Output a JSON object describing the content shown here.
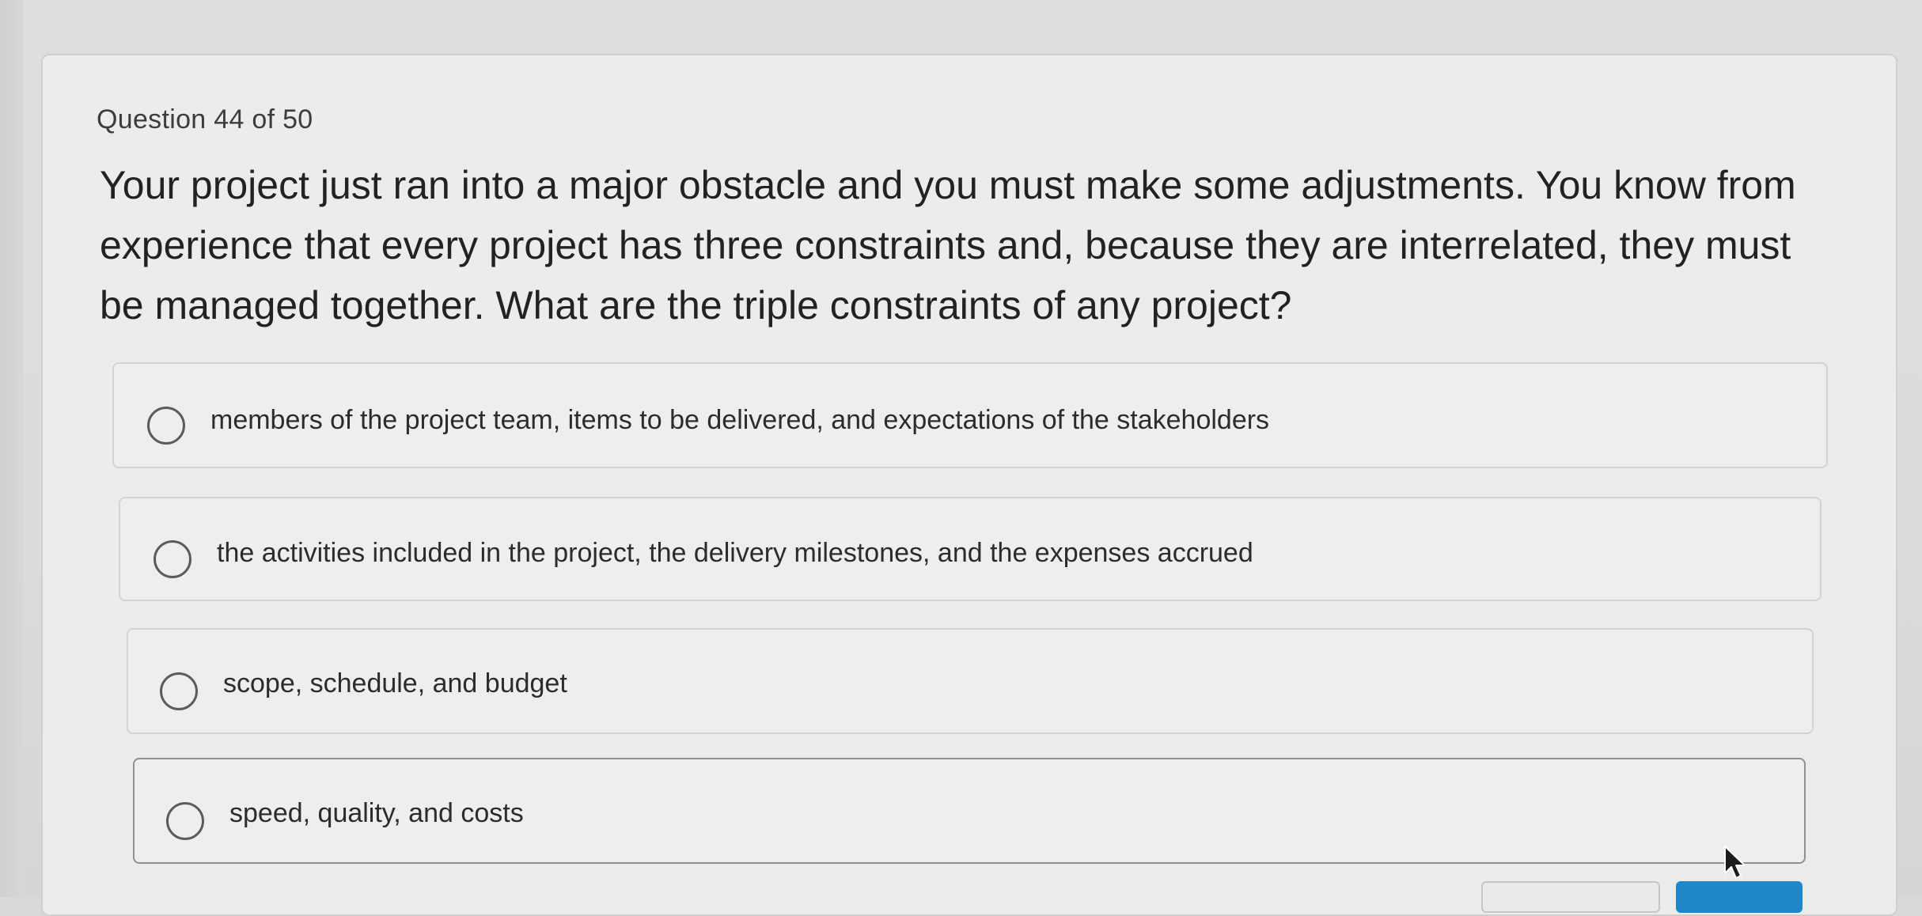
{
  "quiz": {
    "question_number": "Question 44 of 50",
    "question_text": "Your project just ran into a major obstacle and you must make some adjustments. You know from experience that every project has three constraints and, because they are interrelated, they must be managed together. What are the triple constraints of any project?",
    "options": [
      {
        "label": "members of the project team, items to be delivered, and expectations of the stakeholders",
        "selected": false
      },
      {
        "label": "the activities included in the project, the delivery milestones, and the expenses accrued",
        "selected": false
      },
      {
        "label": "scope, schedule, and budget",
        "selected": false
      },
      {
        "label": "speed, quality, and costs",
        "selected": false
      }
    ]
  },
  "colors": {
    "accent_button": "#1f88c9",
    "card_background": "#ecedeb"
  }
}
